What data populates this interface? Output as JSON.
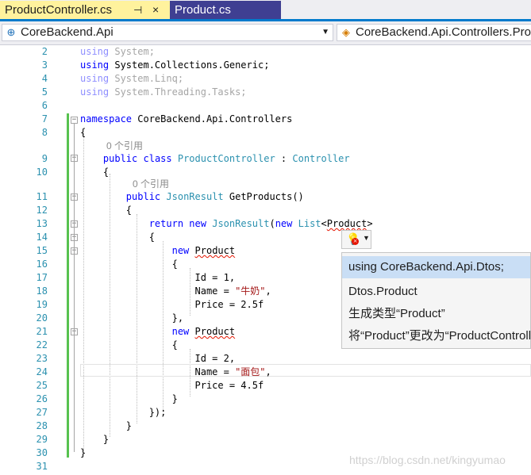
{
  "tabs": {
    "active": {
      "label": "ProductController.cs",
      "pin": "⊣",
      "close": "×"
    },
    "inactive": {
      "label": "Product.cs"
    }
  },
  "navbar": {
    "project": {
      "label": "CoreBackend.Api",
      "icon": "project-icon"
    },
    "class": {
      "label": "CoreBackend.Api.Controllers.ProductController",
      "icon": "class-icon"
    }
  },
  "line_numbers": [
    "2",
    "3",
    "4",
    "5",
    "6",
    "7",
    "8",
    "9",
    "10",
    "11",
    "12",
    "13",
    "14",
    "15",
    "16",
    "17",
    "18",
    "19",
    "20",
    "21",
    "22",
    "23",
    "24",
    "25",
    "26",
    "27",
    "28",
    "29",
    "30",
    "31"
  ],
  "code": {
    "l2": {
      "kw": "using",
      "rest": " System;"
    },
    "l3": {
      "kw": "using",
      "rest": " System.Collections.Generic;"
    },
    "l4": {
      "kw": "using",
      "rest": " System.Linq;"
    },
    "l5": {
      "kw": "using",
      "rest": " System.Threading.Tasks;"
    },
    "l7": {
      "kw": "namespace",
      "rest": " CoreBackend.Api.Controllers"
    },
    "l8": "{",
    "lens1": "0 个引用",
    "l9": {
      "kw1": "public",
      "kw2": "class",
      "name": "ProductController",
      "sep": " : ",
      "base": "Controller"
    },
    "l10": "{",
    "lens2": "0 个引用",
    "l11": {
      "kw": "public",
      "type": "JsonResult",
      "rest": " GetProducts()"
    },
    "l12": "{",
    "l13": {
      "kw1": "return",
      "kw2": "new",
      "type": "JsonResult",
      "paren": "(",
      "kw3": "new",
      "list": "List",
      "lt": "<",
      "gen": "Product",
      "gt": ">"
    },
    "l14": "{",
    "l15": {
      "kw": "new",
      "type": "Product"
    },
    "l16": "{",
    "l17": "Id = 1,",
    "l18": {
      "pre": "Name = ",
      "str": "\"牛奶\"",
      "post": ","
    },
    "l19": "Price = 2.5f",
    "l20": "},",
    "l21": {
      "kw": "new",
      "type": "Product"
    },
    "l22": "{",
    "l23": "Id = 2,",
    "l24": {
      "pre": "Name = ",
      "str": "\"面包\"",
      "post": ","
    },
    "l25": "Price = 4.5f",
    "l26": "}",
    "l27": "});",
    "l28": "}",
    "l29": "}",
    "l30": "}"
  },
  "quick_actions": {
    "icon": "lightbulb-error-icon",
    "items": [
      "using CoreBackend.Api.Dtos;",
      "Dtos.Product",
      "生成类型“Product”",
      "将“Product”更改为“ProductController”"
    ]
  },
  "watermark": "https://blog.csdn.net/kingyumao",
  "colors": {
    "keyword": "#0000ff",
    "type": "#2b91af",
    "string": "#a31515",
    "active_tab": "#fff29d",
    "change_bar": "#57c24f"
  }
}
